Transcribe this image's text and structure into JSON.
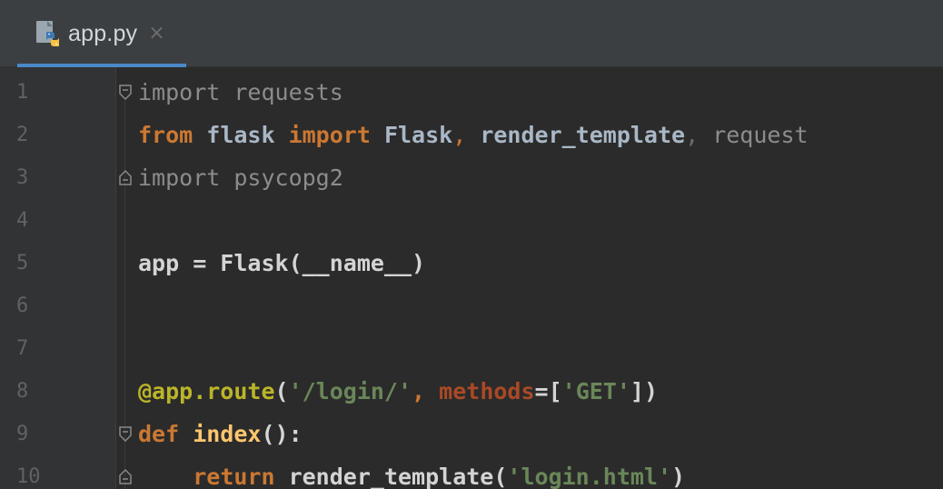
{
  "tab": {
    "label": "app.py",
    "close": "×"
  },
  "lines": {
    "n1": "1",
    "n2": "2",
    "n3": "3",
    "n4": "4",
    "n5": "5",
    "n6": "6",
    "n7": "7",
    "n8": "8",
    "n9": "9",
    "n10": "10"
  },
  "code": {
    "l1_kw": "import",
    "l1_txt": " requests",
    "l2_kw1": "from",
    "l2_txt1": " flask ",
    "l2_kw2": "import",
    "l2_txt2": " Flask",
    "l2_p1": ",",
    "l2_txt3": " render_template",
    "l2_p2": ",",
    "l2_txt4": " request",
    "l3_kw": "import",
    "l3_txt": " psycopg2",
    "l5_txt": "app = Flask(__name__)",
    "l8_deco": "@app.route",
    "l8_open": "(",
    "l8_str1": "'/login/'",
    "l8_comma": ",",
    "l8_param": " methods",
    "l8_eq": "=[",
    "l8_str2": "'GET'",
    "l8_close": "])",
    "l9_kw": "def",
    "l9_fn": " index",
    "l9_rest": "():",
    "l10_indent": "    ",
    "l10_kw": "return",
    "l10_txt": " render_template(",
    "l10_str": "'login.html'",
    "l10_close": ")"
  },
  "colors": {
    "background": "#2b2b2b",
    "gutter": "#313335",
    "tabbar": "#3c3f41",
    "tab_underline": "#4a88c7",
    "keyword": "#cc7832",
    "string": "#6a8759",
    "decorator": "#bbb529",
    "function": "#ffc66d",
    "parameter": "#aa4926",
    "text": "#a9b7c6",
    "unused_import": "#8c8c8c",
    "line_number": "#606366"
  },
  "icons": {
    "tab_icon": "python-file-icon",
    "fold_icon": "fold-marker-icon"
  }
}
